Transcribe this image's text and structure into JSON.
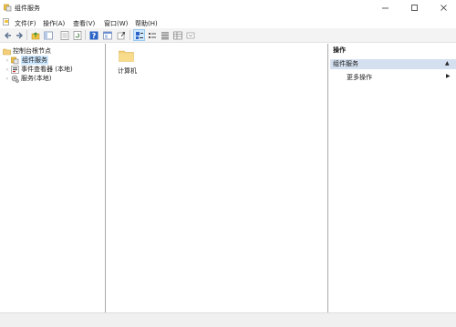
{
  "window": {
    "title": "组件服务",
    "controls": {
      "minimize": "—",
      "maximize": "☐",
      "close": "✕"
    }
  },
  "menu": {
    "items": [
      {
        "label": "文件(F)"
      },
      {
        "label": "操作(A)"
      },
      {
        "label": "查看(V)"
      },
      {
        "label": "窗口(W)"
      },
      {
        "label": "帮助(H)"
      }
    ]
  },
  "toolbar": {
    "buttons": [
      "back-arrow-icon",
      "forward-arrow-icon",
      "up-folder-icon",
      "show-tree-icon",
      "properties-icon",
      "refresh-icon",
      "help-icon",
      "window-icon",
      "export-icon",
      "large-icons-icon",
      "small-icons-icon",
      "list-view-icon",
      "detail-view-icon",
      "configure-icon"
    ]
  },
  "tree": {
    "root": "控制台根节点",
    "children": [
      {
        "label": "组件服务",
        "selected": true
      },
      {
        "label": "事件查看器 (本地)"
      },
      {
        "label": "服务(本地)"
      }
    ]
  },
  "center": {
    "items": [
      {
        "label": "计算机",
        "icon": "folder-icon"
      }
    ]
  },
  "actions": {
    "header": "操作",
    "group": "组件服务",
    "group_arrow": "▲",
    "more": "更多操作",
    "more_arrow": "▶"
  },
  "colors": {
    "selection": "#cde8ff",
    "actions_group_bg": "#d4dfef",
    "folder": "#f5d07a"
  }
}
